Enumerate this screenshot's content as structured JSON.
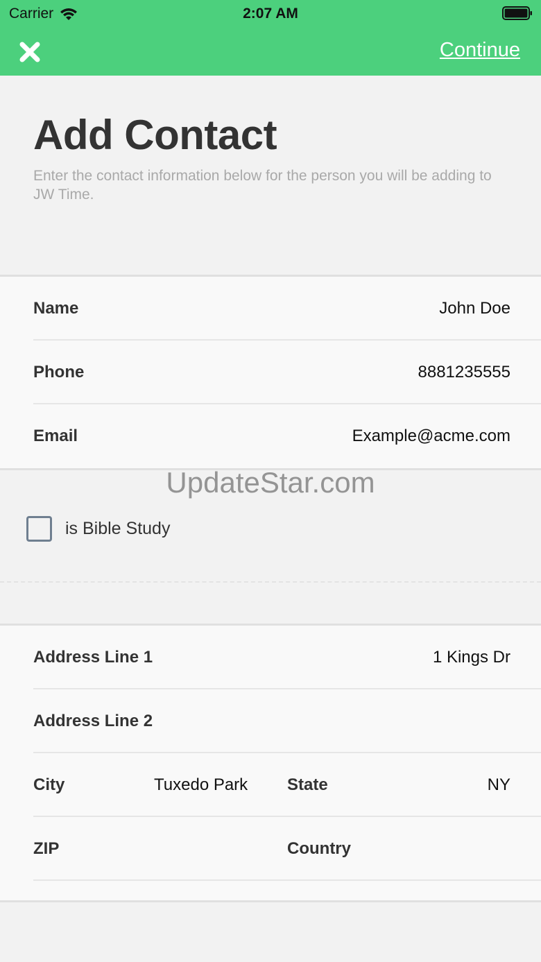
{
  "status": {
    "carrier": "Carrier",
    "time": "2:07 AM"
  },
  "nav": {
    "continue_label": "Continue"
  },
  "header": {
    "title": "Add Contact",
    "subtitle": "Enter the contact information below for the person you will be adding to JW Time."
  },
  "contact": {
    "name_label": "Name",
    "name_value": "John Doe",
    "phone_label": "Phone",
    "phone_value": "8881235555",
    "email_label": "Email",
    "email_value": "Example@acme.com"
  },
  "bible_study": {
    "label": "is Bible Study",
    "checked": false
  },
  "watermark": "UpdateStar.com",
  "address": {
    "line1_label": "Address Line 1",
    "line1_value": "1  Kings Dr",
    "line2_label": "Address Line 2",
    "line2_value": "",
    "city_label": "City",
    "city_value": "Tuxedo Park",
    "state_label": "State",
    "state_value": "NY",
    "zip_label": "ZIP",
    "zip_value": "",
    "country_label": "Country",
    "country_value": ""
  },
  "colors": {
    "accent": "#4cd07d",
    "background": "#f2f2f2",
    "card": "#f9f9f9"
  }
}
